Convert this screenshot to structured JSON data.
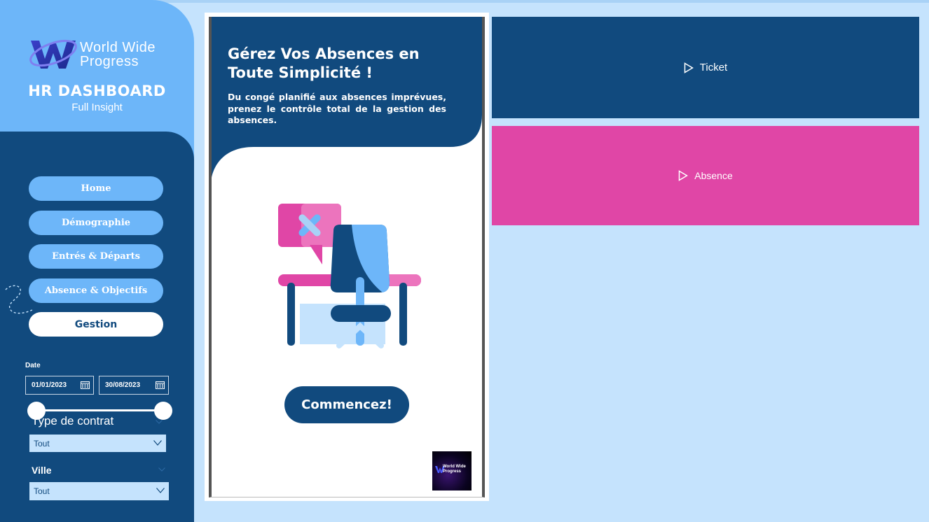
{
  "brand": {
    "logo_line1": "World Wide",
    "logo_line2": "Progress",
    "dashboard_title": "HR DASHBOARD",
    "dashboard_subtitle": "Full Insight"
  },
  "nav": {
    "items": [
      {
        "label": "Home"
      },
      {
        "label": "Démographie"
      },
      {
        "label": "Entrés & Départs"
      },
      {
        "label": "Absence & Objectifs"
      },
      {
        "label": "Gestion",
        "active": true
      }
    ]
  },
  "filters": {
    "date_label": "Date",
    "date_start": "01/01/2023",
    "date_end": "30/08/2023",
    "contract_label": "Type de contrat",
    "contract_value": "Tout",
    "city_label": "Ville",
    "city_value": "Tout"
  },
  "card": {
    "title": "Gérez Vos Absences en Toute Simplicité !",
    "description": "Du congé planifié aux absences imprévues, prenez le contrôle total de la gestion des absences.",
    "cta_label": "Commencez!",
    "mini_logo_line1": "World Wide",
    "mini_logo_line2": "Progress"
  },
  "panels": {
    "ticket_label": "Ticket",
    "absence_label": "Absence"
  },
  "colors": {
    "background": "#c5e3fd",
    "navy": "#114a7e",
    "sky": "#6db6f9",
    "pink": "#e046a6"
  },
  "icons": [
    "brand-logo",
    "calendar-icon",
    "chevron-down-icon",
    "play-icon",
    "desk-absence-illustration"
  ]
}
